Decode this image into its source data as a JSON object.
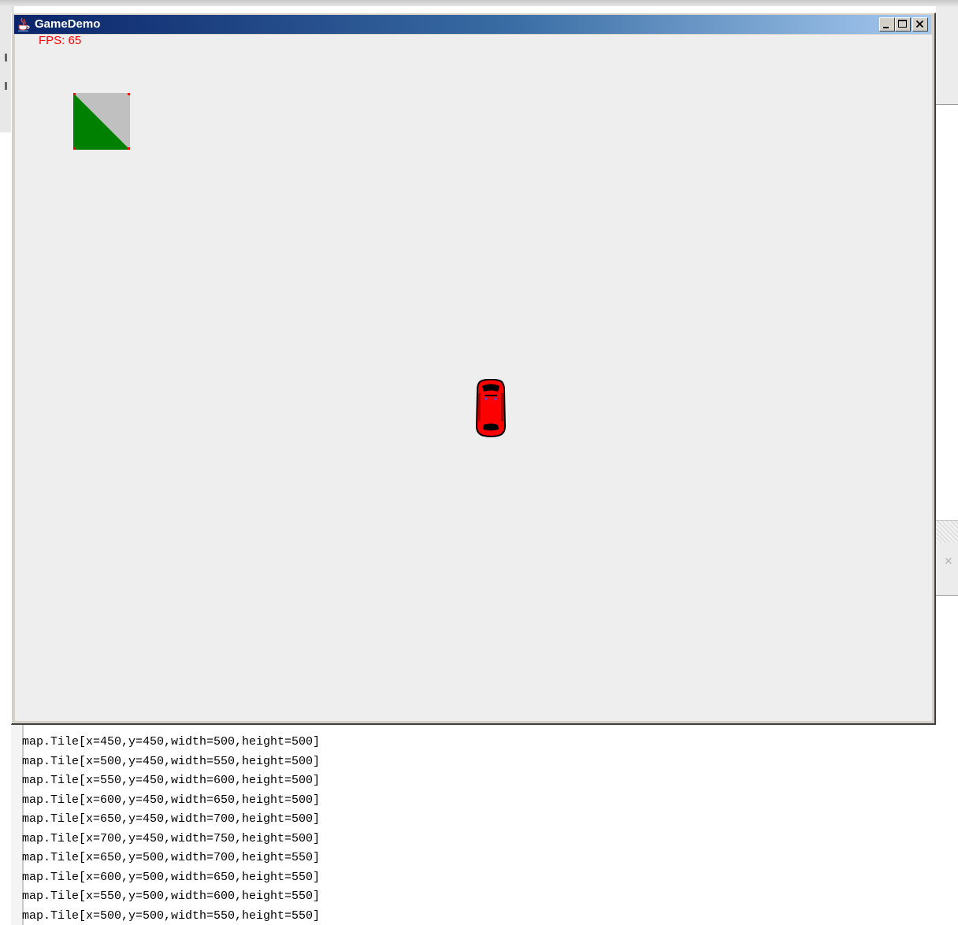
{
  "window": {
    "title": "GameDemo",
    "fps_label": "FPS: 65",
    "title_icon": "java-cup-icon",
    "controls": [
      "minimize-icon",
      "maximize-icon",
      "close-icon"
    ]
  },
  "game": {
    "tile_colors": {
      "fill": "#008000",
      "background": "#c0c0c0",
      "corners": "#ff0000"
    },
    "car_color": "#ff0000",
    "canvas_color": "#eeeeee"
  },
  "console": {
    "lines": [
      "map.Tile[x=450,y=450,width=500,height=500]",
      "map.Tile[x=500,y=450,width=550,height=500]",
      "map.Tile[x=550,y=450,width=600,height=500]",
      "map.Tile[x=600,y=450,width=650,height=500]",
      "map.Tile[x=650,y=450,width=700,height=500]",
      "map.Tile[x=700,y=450,width=750,height=500]",
      "map.Tile[x=650,y=500,width=700,height=550]",
      "map.Tile[x=600,y=500,width=650,height=550]",
      "map.Tile[x=550,y=500,width=600,height=550]",
      "map.Tile[x=500,y=500,width=550,height=550]"
    ]
  }
}
